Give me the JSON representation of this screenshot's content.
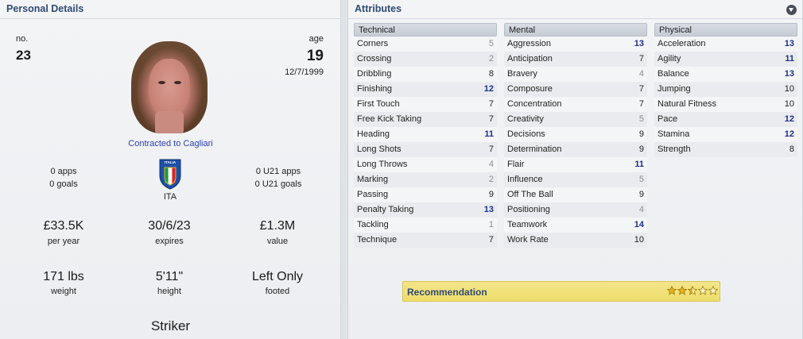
{
  "personal": {
    "title": "Personal Details",
    "number_label": "no.",
    "number": "23",
    "age_label": "age",
    "age": "19",
    "dob": "12/7/1999",
    "contract_text": "Contracted to Cagliari",
    "apps": "0 apps",
    "goals": "0 goals",
    "u21_apps": "0 U21 apps",
    "u21_goals": "0 U21 goals",
    "nation": "ITA",
    "crest_text": "ITALIA",
    "wage": "£33.5K",
    "wage_label": "per year",
    "expires": "30/6/23",
    "expires_label": "expires",
    "value": "£1.3M",
    "value_label": "value",
    "weight": "171 lbs",
    "weight_label": "weight",
    "height": "5'11\"",
    "height_label": "height",
    "foot": "Left Only",
    "foot_label": "footed",
    "position": "Striker"
  },
  "attributes": {
    "title": "Attributes",
    "technical": {
      "header": "Technical",
      "rows": [
        {
          "name": "Corners",
          "value": "5"
        },
        {
          "name": "Crossing",
          "value": "2"
        },
        {
          "name": "Dribbling",
          "value": "8"
        },
        {
          "name": "Finishing",
          "value": "12"
        },
        {
          "name": "First Touch",
          "value": "7"
        },
        {
          "name": "Free Kick Taking",
          "value": "7"
        },
        {
          "name": "Heading",
          "value": "11"
        },
        {
          "name": "Long Shots",
          "value": "7"
        },
        {
          "name": "Long Throws",
          "value": "4"
        },
        {
          "name": "Marking",
          "value": "2"
        },
        {
          "name": "Passing",
          "value": "9"
        },
        {
          "name": "Penalty Taking",
          "value": "13"
        },
        {
          "name": "Tackling",
          "value": "1"
        },
        {
          "name": "Technique",
          "value": "7"
        }
      ]
    },
    "mental": {
      "header": "Mental",
      "rows": [
        {
          "name": "Aggression",
          "value": "13"
        },
        {
          "name": "Anticipation",
          "value": "7"
        },
        {
          "name": "Bravery",
          "value": "4"
        },
        {
          "name": "Composure",
          "value": "7"
        },
        {
          "name": "Concentration",
          "value": "7"
        },
        {
          "name": "Creativity",
          "value": "5"
        },
        {
          "name": "Decisions",
          "value": "9"
        },
        {
          "name": "Determination",
          "value": "9"
        },
        {
          "name": "Flair",
          "value": "11"
        },
        {
          "name": "Influence",
          "value": "5"
        },
        {
          "name": "Off The Ball",
          "value": "9"
        },
        {
          "name": "Positioning",
          "value": "4"
        },
        {
          "name": "Teamwork",
          "value": "14"
        },
        {
          "name": "Work Rate",
          "value": "10"
        }
      ]
    },
    "physical": {
      "header": "Physical",
      "rows": [
        {
          "name": "Acceleration",
          "value": "13"
        },
        {
          "name": "Agility",
          "value": "11"
        },
        {
          "name": "Balance",
          "value": "13"
        },
        {
          "name": "Jumping",
          "value": "10"
        },
        {
          "name": "Natural Fitness",
          "value": "10"
        },
        {
          "name": "Pace",
          "value": "12"
        },
        {
          "name": "Stamina",
          "value": "12"
        },
        {
          "name": "Strength",
          "value": "8"
        }
      ]
    }
  },
  "recommendation": {
    "label": "Recommendation",
    "stars": 2.5,
    "max_stars": 5
  },
  "colors": {
    "heading": "#2f4a72",
    "high_value": "#1d2f8c",
    "low_value": "#8a8d92",
    "link": "#2a3fb0",
    "recommendation_bg": "#eedd6b"
  }
}
